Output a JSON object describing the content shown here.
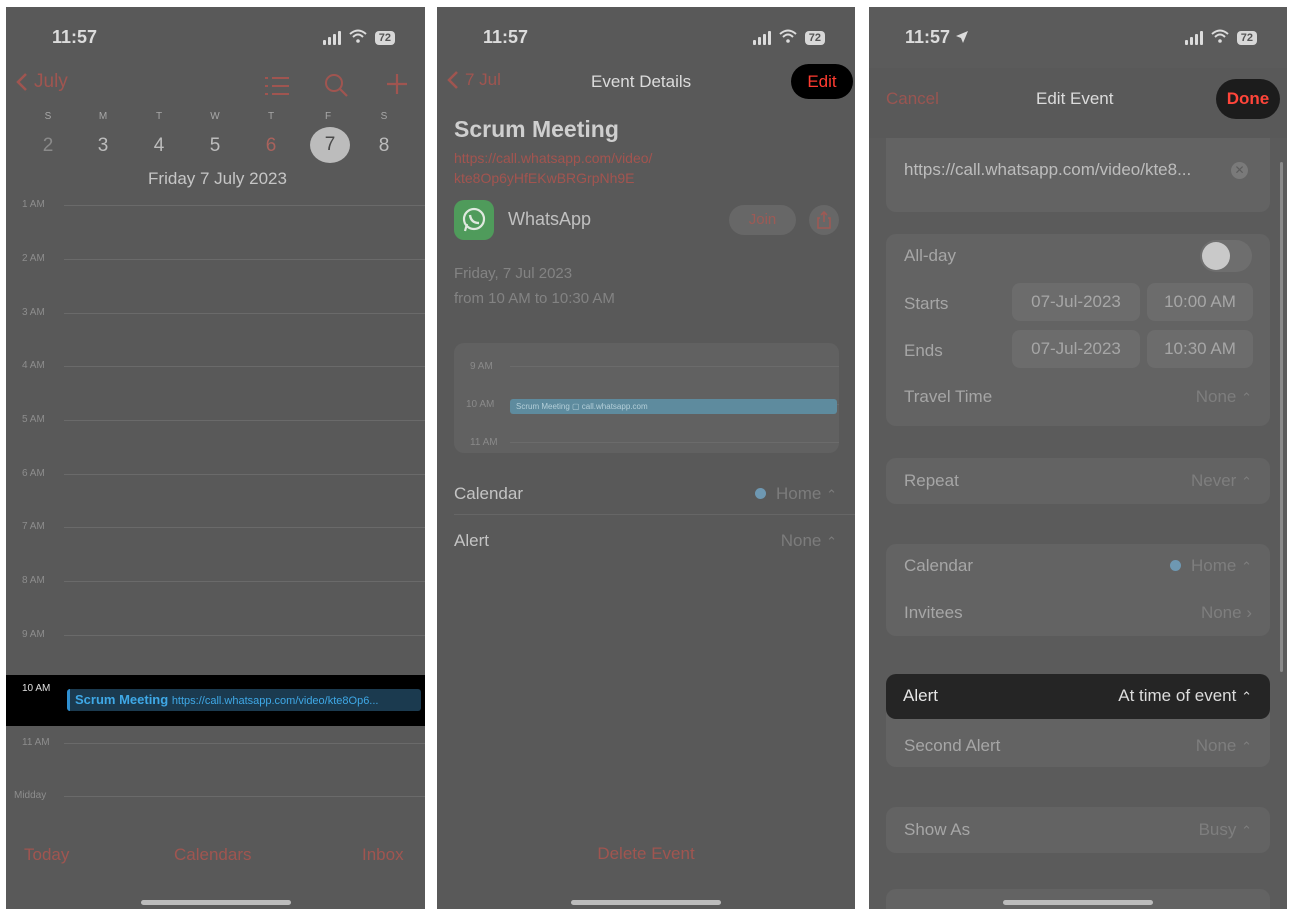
{
  "status": {
    "time1": "11:57",
    "time2": "11:57",
    "time3": "11:57",
    "battery": "72"
  },
  "calendar_day": {
    "back_label": "July",
    "weekdays": [
      "S",
      "M",
      "T",
      "W",
      "T",
      "F",
      "S"
    ],
    "dates": [
      "2",
      "3",
      "4",
      "5",
      "6",
      "7",
      "8"
    ],
    "date_caption": "Friday  7 July 2023",
    "hours": [
      "1 AM",
      "2 AM",
      "3 AM",
      "4 AM",
      "5 AM",
      "6 AM",
      "7 AM",
      "8 AM",
      "9 AM",
      "10 AM",
      "11 AM",
      "Midday"
    ],
    "event_title": "Scrum Meeting",
    "event_link": "https://call.whatsapp.com/video/kte8Op6...",
    "tabs": {
      "today": "Today",
      "calendars": "Calendars",
      "inbox": "Inbox"
    }
  },
  "event_details": {
    "back_label": "7 Jul",
    "title": "Event Details",
    "edit_label": "Edit",
    "event_title": "Scrum Meeting",
    "link_line1": "https://call.whatsapp.com/video/",
    "link_line2": "kte8Op6yHfEKwBRGrpNh9E",
    "app_name": "WhatsApp",
    "join_label": "Join",
    "date_line": "Friday, 7 Jul 2023",
    "time_line": "from 10 AM to 10:30 AM",
    "mini_hours": [
      "9 AM",
      "10 AM",
      "11 AM"
    ],
    "mini_event": "Scrum Meeting  ▢ call.whatsapp.com",
    "calendar_label": "Calendar",
    "calendar_value": "Home",
    "alert_label": "Alert",
    "alert_value": "None",
    "delete_label": "Delete Event"
  },
  "edit_event": {
    "cancel_label": "Cancel",
    "title": "Edit Event",
    "done_label": "Done",
    "url_value": "https://call.whatsapp.com/video/kte8...",
    "allday_label": "All-day",
    "starts_label": "Starts",
    "starts_date": "07-Jul-2023",
    "starts_time": "10:00 AM",
    "ends_label": "Ends",
    "ends_date": "07-Jul-2023",
    "ends_time": "10:30 AM",
    "travel_label": "Travel Time",
    "travel_value": "None",
    "repeat_label": "Repeat",
    "repeat_value": "Never",
    "calendar_label": "Calendar",
    "calendar_value": "Home",
    "invitees_label": "Invitees",
    "invitees_value": "None",
    "alert_label": "Alert",
    "alert_value": "At time of event",
    "second_alert_label": "Second Alert",
    "second_alert_value": "None",
    "show_as_label": "Show As",
    "show_as_value": "Busy"
  },
  "colors": {
    "accent_red": "#ff3b30",
    "event_blue": "#3fa8e6",
    "home_dot": "#6e98b2"
  }
}
